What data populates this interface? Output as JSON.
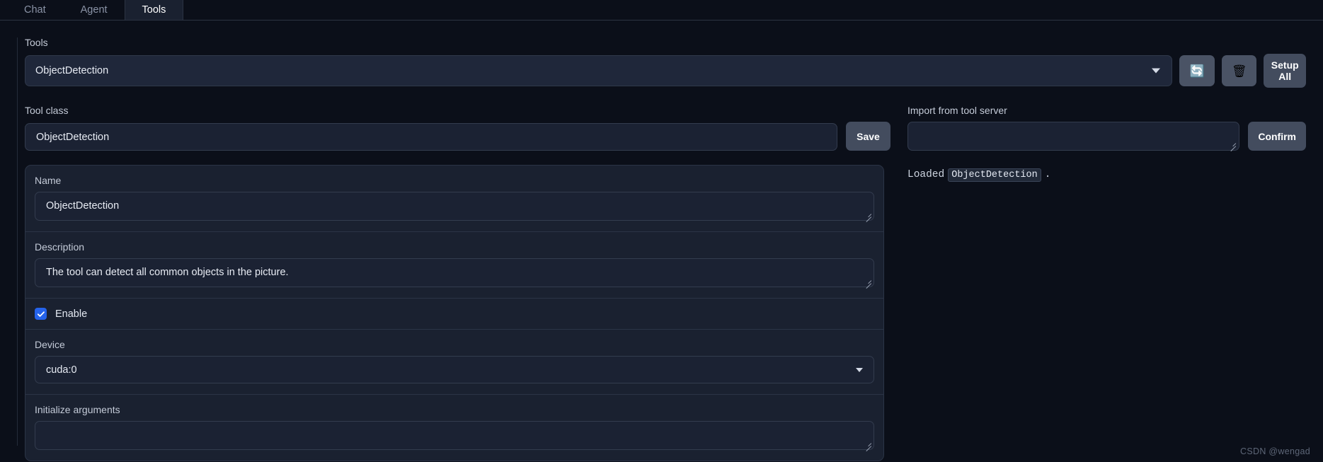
{
  "tabs": [
    {
      "label": "Chat",
      "active": false
    },
    {
      "label": "Agent",
      "active": false
    },
    {
      "label": "Tools",
      "active": true
    }
  ],
  "tools_section": {
    "label": "Tools",
    "selected_tool": "ObjectDetection",
    "caret_icon": "chevron-down-icon",
    "refresh_button_icon": "refresh-icon",
    "refresh_button_glyph": "🔄",
    "delete_button_icon": "trash-icon",
    "delete_button_glyph": "🗑",
    "setup_all_label": "Setup All"
  },
  "tool_class": {
    "label": "Tool class",
    "value": "ObjectDetection",
    "save_label": "Save"
  },
  "detail_card": {
    "name": {
      "label": "Name",
      "value": "ObjectDetection"
    },
    "description": {
      "label": "Description",
      "value": "The tool can detect all common objects in the picture."
    },
    "enable": {
      "label": "Enable",
      "checked": true
    },
    "device": {
      "label": "Device",
      "value": "cuda:0",
      "caret_icon": "chevron-down-icon"
    },
    "init_args": {
      "label": "Initialize arguments",
      "value": ""
    }
  },
  "import_panel": {
    "label": "Import from tool server",
    "input_value": "",
    "confirm_label": "Confirm",
    "status_prefix": "Loaded",
    "status_code": "ObjectDetection",
    "status_suffix": "."
  },
  "watermark": "CSDN @wengad",
  "colors": {
    "background": "#0b0f19",
    "panel": "#1a2130",
    "field": "#1b2233",
    "accent": "#2563eb",
    "button": "#434c5e",
    "border": "#2b3446",
    "text": "#e8ecf4",
    "muted": "#8a93a6"
  }
}
